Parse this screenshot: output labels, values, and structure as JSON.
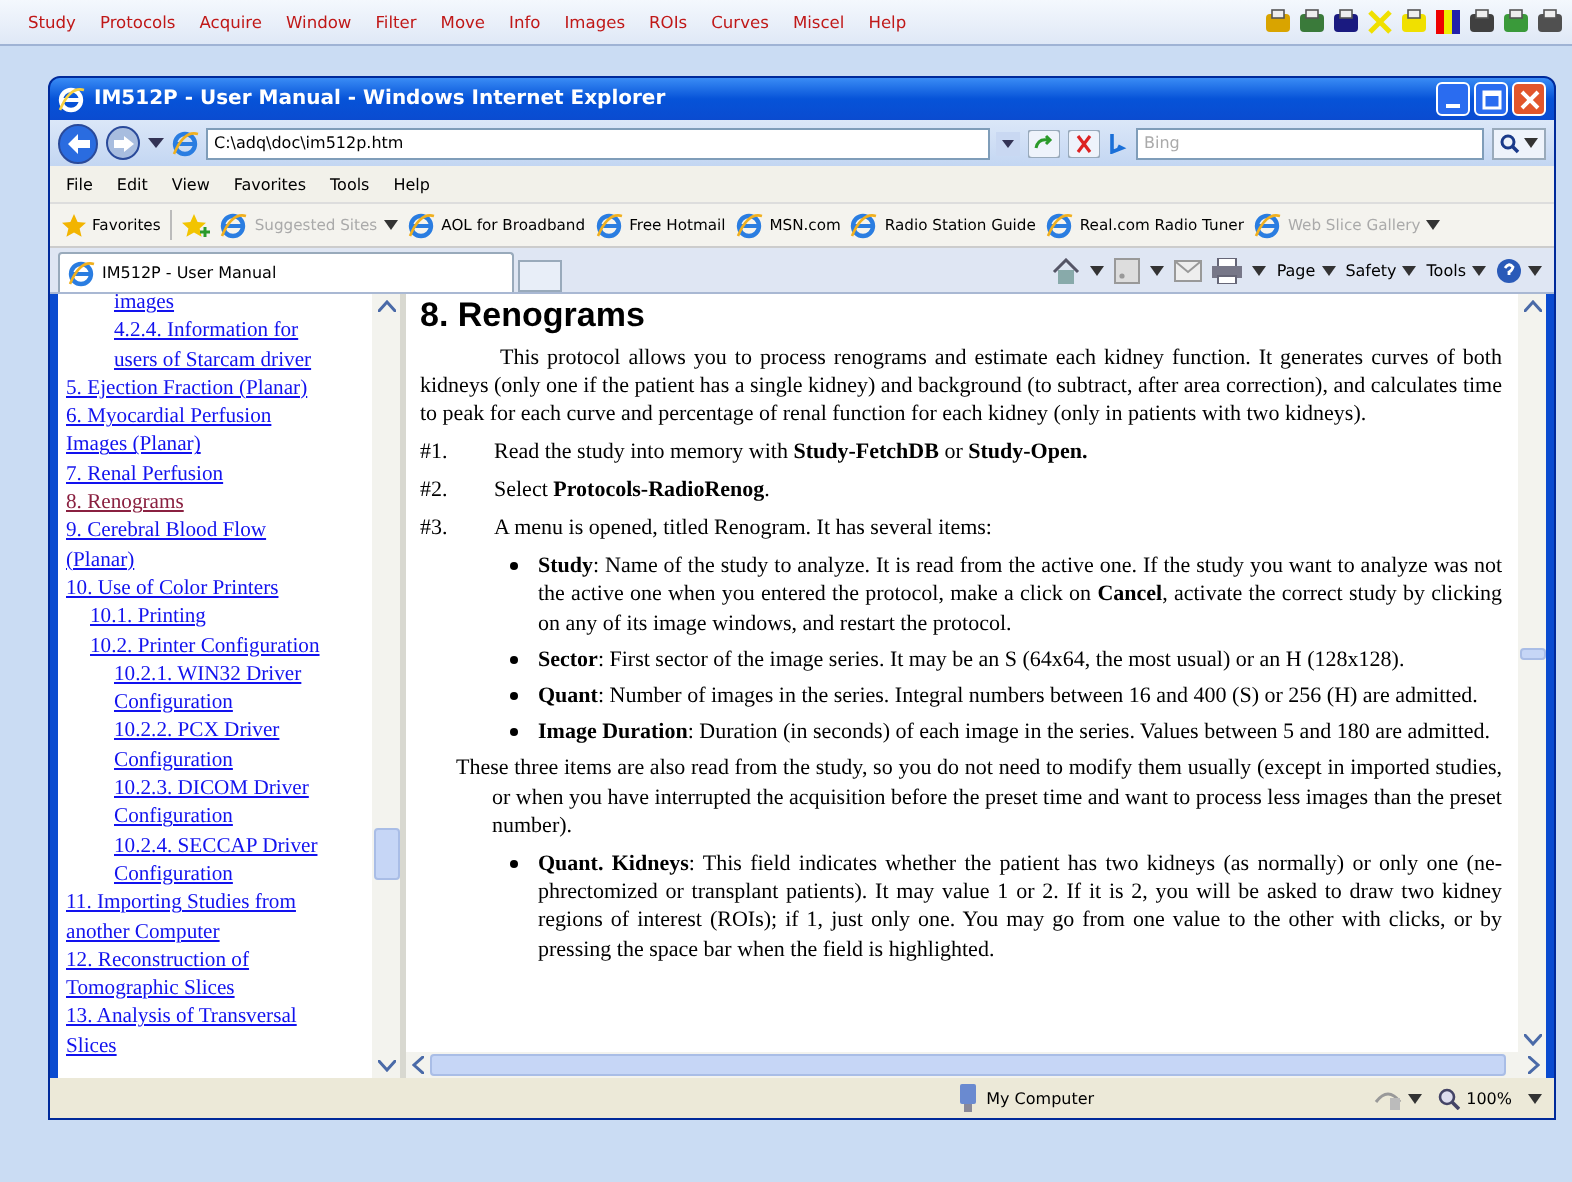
{
  "app_menu": [
    "Study",
    "Protocols",
    "Acquire",
    "Window",
    "Filter",
    "Move",
    "Info",
    "Images",
    "ROIs",
    "Curves",
    "Miscel",
    "Help"
  ],
  "window": {
    "title": "IM512P - User Manual - Windows Internet Explorer"
  },
  "address": {
    "value": "C:\\adq\\doc\\im512p.htm"
  },
  "search": {
    "placeholder": "Bing"
  },
  "menu": [
    "File",
    "Edit",
    "View",
    "Favorites",
    "Tools",
    "Help"
  ],
  "favorites": {
    "label": "Favorites",
    "items": [
      {
        "label": "Suggested Sites",
        "disabled": true,
        "dropdown": true
      },
      {
        "label": "AOL for Broadband",
        "disabled": false,
        "dropdown": false
      },
      {
        "label": "Free Hotmail",
        "disabled": false,
        "dropdown": false
      },
      {
        "label": "MSN.com",
        "disabled": false,
        "dropdown": false
      },
      {
        "label": "Radio Station Guide",
        "disabled": false,
        "dropdown": false
      },
      {
        "label": "Real.com Radio Tuner",
        "disabled": false,
        "dropdown": false
      },
      {
        "label": "Web Slice Gallery",
        "disabled": true,
        "dropdown": true
      }
    ]
  },
  "tabs": [
    {
      "label": "IM512P - User Manual",
      "selected": true
    }
  ],
  "commands": [
    "Page",
    "Safety",
    "Tools"
  ],
  "toc": [
    {
      "children": [
        {
          "children": [
            {
              "label": "images",
              "visited": false
            },
            {
              "label": "4.2.4. Information for users of Starcam driver",
              "visited": false
            }
          ]
        }
      ]
    },
    {
      "label": "5. Ejection Fraction (Planar)",
      "visited": false
    },
    {
      "label": "6. Myocardial Perfusion Images (Planar)",
      "visited": false
    },
    {
      "label": "7. Renal Perfusion",
      "visited": false
    },
    {
      "label": "8. Renograms",
      "visited": true
    },
    {
      "label": "9. Cerebral Blood Flow (Planar)",
      "visited": false
    },
    {
      "label": "10. Use of Color Printers",
      "visited": false,
      "children": [
        {
          "label": "10.1. Printing",
          "visited": false
        },
        {
          "label": "10.2. Printer Configuration",
          "visited": false,
          "children": [
            {
              "label": "10.2.1. WIN32 Driver Configuration",
              "visited": false
            },
            {
              "label": "10.2.2. PCX Driver Configuration",
              "visited": false
            },
            {
              "label": "10.2.3. DICOM Driver Configuration",
              "visited": false
            },
            {
              "label": "10.2.4. SECCAP Driver Configuration",
              "visited": false
            }
          ]
        }
      ]
    },
    {
      "label": "11. Importing Studies from another Computer",
      "visited": false
    },
    {
      "label": "12. Reconstruction of Tomographic Slices",
      "visited": false
    },
    {
      "label": "13. Analysis of Transversal Slices",
      "visited": false
    }
  ],
  "article": {
    "heading": "8. Renograms",
    "blocks": [
      {
        "kind": "para",
        "text": "This protocol allows you to process renograms and estimate each kidney function. It generates curves of both kidneys (only one if the patient has a single kidney) and background (to subtract, after area correction), and calculates time to peak for each curve and percentage of renal function for each kidney (only in patients with two kidneys)."
      },
      {
        "kind": "step",
        "num": "#1.",
        "text": "Read the study into memory with **Study-FetchDB** or **Study-Open.**"
      },
      {
        "kind": "step",
        "num": "#2.",
        "text": "Select **Protocols-RadioRenog**."
      },
      {
        "kind": "step",
        "num": "#3.",
        "text": "A menu is opened, titled Renogram. It has several items:"
      },
      {
        "kind": "bullet",
        "text": "**Study**: Name of the study to analyze. It is read from the active one. If the study you want to analyze was not the active one when you entered the protocol, make a click on **Cancel**, activate the correct study by clicking on any of its image windows, and restart the protocol."
      },
      {
        "kind": "bullet",
        "text": "**Sector**: First sector of the image series. It may be an S (64x64, the most usual) or an H (128x128)."
      },
      {
        "kind": "bullet",
        "text": "**Quant**: Number of images in the series. Integral numbers between 16 and 400 (S) or 256 (H) are admitted."
      },
      {
        "kind": "bullet",
        "text": "**Image Duration**: Duration (in seconds) of each image in the series. Values between 5 and 180 are admitted."
      },
      {
        "kind": "note",
        "text": "These three items are also read from the study, so you do not need to modify them usually (except in imported studies, or when you have interrupted the acquisition before the preset time and want to process less images than the preset number)."
      },
      {
        "kind": "bullet",
        "text": "**Quant. Kidneys**: This field indicates whether the patient has two kidneys (as normally) or only one (ne-phrectomized or transplant patients). It may value 1 or 2. If it is 2, you will be asked to draw two kidney regions of interest (ROIs); if 1, just only one. You may go from one value to the other with clicks, or by pressing the space bar when the field is highlighted."
      }
    ]
  },
  "status": {
    "zone": "My Computer",
    "zoom": "100%"
  }
}
